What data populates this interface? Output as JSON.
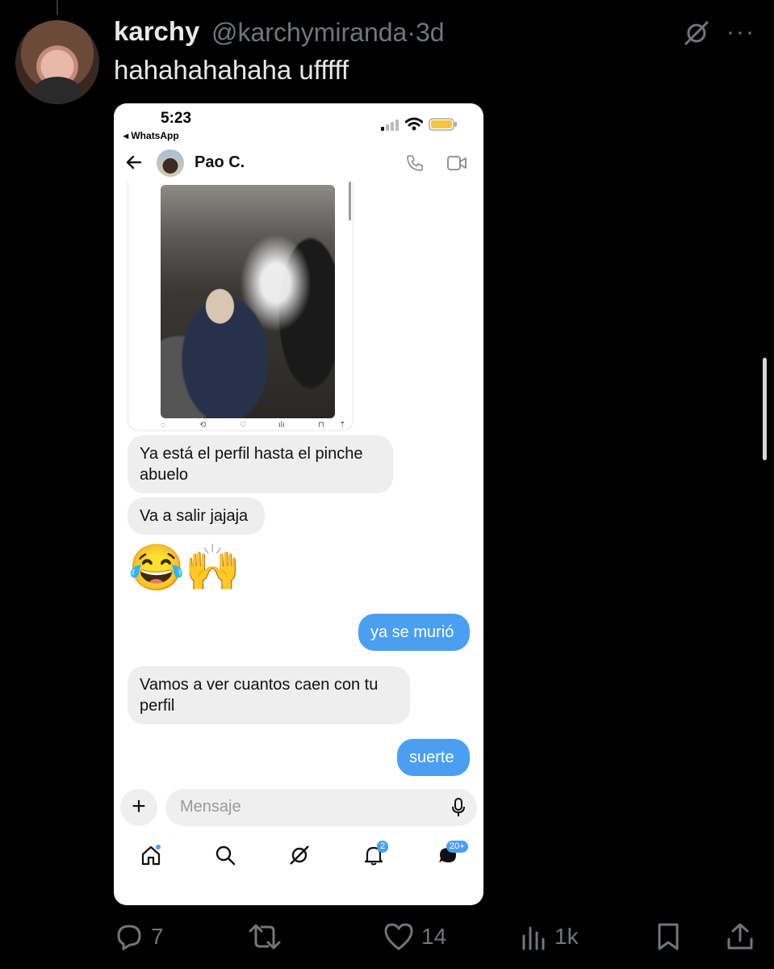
{
  "tweet": {
    "author_name": "karchy",
    "author_handle": "@karchymiranda",
    "separator": "·",
    "time": "3d",
    "text": "hahahahahaha ufffff",
    "more": "···"
  },
  "phone": {
    "status_time": "5:23",
    "back_app": "◂ WhatsApp",
    "chat_name": "Pao C.",
    "messages": [
      {
        "from": "them",
        "text": "Ya está el perfil hasta el pinche abuelo"
      },
      {
        "from": "them",
        "text": "Va a salir jajaja"
      },
      {
        "from": "them",
        "text": "😂🙌"
      },
      {
        "from": "me",
        "text": "ya se murió"
      },
      {
        "from": "them",
        "text": "Vamos a ver cuantos caen con tu perfil"
      },
      {
        "from": "me",
        "text": "suerte"
      }
    ],
    "composer_placeholder": "Mensaje",
    "composer_plus": "+",
    "tabs": {
      "notifications_badge": "2",
      "messages_badge": "20+"
    },
    "embedded_actions": [
      "◌",
      "⟲",
      "♡",
      "ılı",
      "⊓",
      "⇡"
    ]
  },
  "actions": {
    "replies": "7",
    "reposts": "",
    "likes": "14",
    "views": "1k"
  },
  "colors": {
    "background": "#000000",
    "bubble_outgoing": "#4a9ff2",
    "bubble_incoming": "#eeeeee",
    "muted": "#71767b"
  }
}
